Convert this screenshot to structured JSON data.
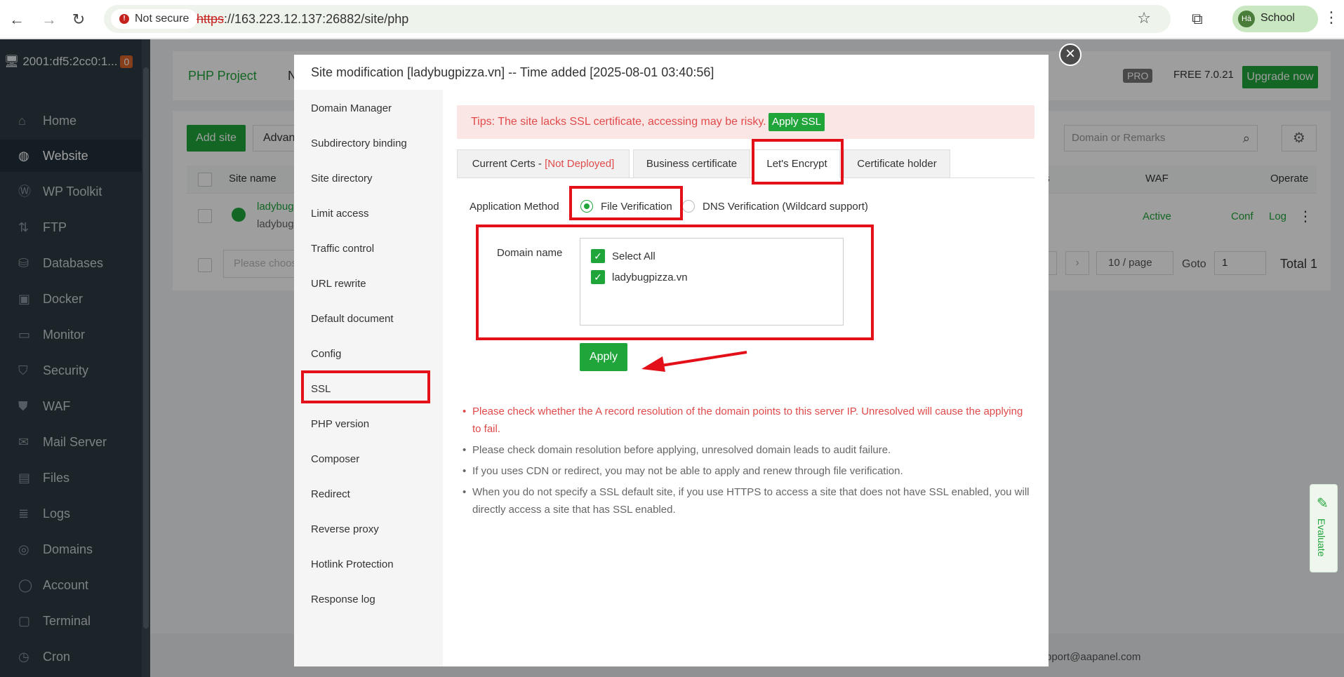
{
  "browser": {
    "security_label": "Not secure",
    "url_scheme": "https",
    "url_rest": "://163.223.12.137:26882/site/php",
    "profile_initials": "Hà",
    "profile_name": "School"
  },
  "sidebar": {
    "server_name": "2001:df5:2cc0:1...",
    "server_badge": "0",
    "items": [
      {
        "label": "Home",
        "icon": "home-icon"
      },
      {
        "label": "Website",
        "icon": "globe-icon",
        "active": true
      },
      {
        "label": "WP Toolkit",
        "icon": "wordpress-icon"
      },
      {
        "label": "FTP",
        "icon": "ftp-icon"
      },
      {
        "label": "Databases",
        "icon": "database-icon"
      },
      {
        "label": "Docker",
        "icon": "docker-icon"
      },
      {
        "label": "Monitor",
        "icon": "monitor-icon"
      },
      {
        "label": "Security",
        "icon": "shield-icon"
      },
      {
        "label": "WAF",
        "icon": "waf-shield-icon"
      },
      {
        "label": "Mail Server",
        "icon": "mail-icon"
      },
      {
        "label": "Files",
        "icon": "folder-icon"
      },
      {
        "label": "Logs",
        "icon": "logs-icon"
      },
      {
        "label": "Domains",
        "icon": "domains-icon"
      },
      {
        "label": "Account",
        "icon": "user-icon"
      },
      {
        "label": "Terminal",
        "icon": "terminal-icon"
      },
      {
        "label": "Cron",
        "icon": "clock-icon"
      }
    ]
  },
  "background": {
    "tab_php": "PHP Project",
    "tab_n": "N",
    "pro": "PRO",
    "free_version": "FREE   7.0.21",
    "upgrade": "Upgrade now",
    "add_site": "Add site",
    "advanced": "Advan",
    "search_placeholder": "Domain or Remarks",
    "col_site": "Site name",
    "col_ts": "ts",
    "col_waf": "WAF",
    "col_operate": "Operate",
    "row_site_1": "ladybug",
    "row_site_2": "ladybug",
    "row_waf": "Active",
    "row_conf": "Conf",
    "row_log": "Log",
    "choose_placeholder": "Please choos",
    "per_page": "10 / page",
    "goto_label": "Goto",
    "goto_value": "1",
    "total": "Total 1",
    "support_email": "pport@aapanel.com",
    "evaluate": "Evaluate"
  },
  "modal": {
    "title": "Site modification [ladybugpizza.vn] -- Time added [2025-08-01 03:40:56]",
    "nav": [
      "Domain Manager",
      "Subdirectory binding",
      "Site directory",
      "Limit access",
      "Traffic control",
      "URL rewrite",
      "Default document",
      "Config",
      "SSL",
      "PHP version",
      "Composer",
      "Redirect",
      "Reverse proxy",
      "Hotlink Protection",
      "Response log"
    ],
    "tips": "Tips: The site lacks SSL certificate, accessing may be risky.",
    "apply_ssl": "Apply SSL",
    "tabs": {
      "current_certs": "Current Certs - ",
      "not_deployed": "[Not Deployed]",
      "business": "Business certificate",
      "lets_encrypt": "Let's Encrypt",
      "holder": "Certificate holder"
    },
    "app_method_label": "Application Method",
    "method_file": "File Verification",
    "method_dns": "DNS Verification (Wildcard support)",
    "domain_label": "Domain name",
    "select_all": "Select All",
    "domain": "ladybugpizza.vn",
    "apply": "Apply",
    "notes": [
      "Please check whether the A record resolution of the domain points to this server IP. Unresolved will cause the applying to fail.",
      "Please check domain resolution before applying, unresolved domain leads to audit failure.",
      "If you uses CDN or redirect, you may not be able to apply and renew through file verification.",
      "When you do not specify a SSL default site, if you use HTTPS to access a site that does not have SSL enabled, you will directly access a site that has SSL enabled."
    ]
  },
  "colors": {
    "accent": "#20a53a",
    "warning": "#e04a4a",
    "highlight": "#e3101a",
    "sidebar_bg": "#2d3a43"
  }
}
